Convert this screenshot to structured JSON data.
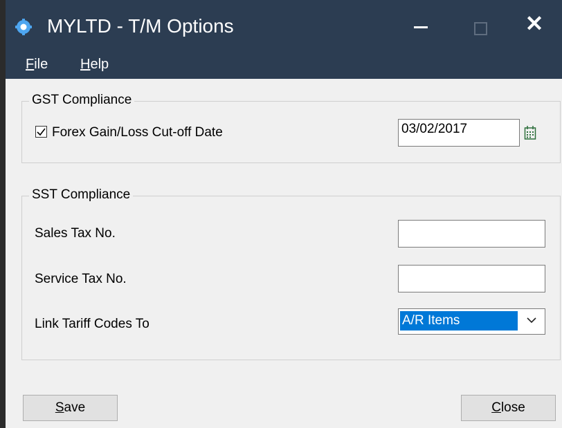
{
  "window": {
    "title": "MYLTD - T/M Options",
    "icon": "gear-icon",
    "title_bar_color": "#2c3d52"
  },
  "menu": {
    "file": {
      "accel": "F",
      "rest": "ile"
    },
    "help": {
      "accel": "H",
      "rest": "elp"
    }
  },
  "gst": {
    "group_title": "GST Compliance",
    "checkbox_label": "Forex Gain/Loss Cut-off Date",
    "checked": true,
    "date_value": "03/02/2017",
    "calendar_icon": "calendar-icon"
  },
  "sst": {
    "group_title": "SST Compliance",
    "sales_tax_label": "Sales Tax No.",
    "sales_tax_value": "",
    "service_tax_label": "Service Tax No.",
    "service_tax_value": "",
    "link_tariff_label": "Link Tariff Codes To",
    "link_tariff_value": "A/R Items"
  },
  "buttons": {
    "save": {
      "accel": "S",
      "rest": "ave"
    },
    "close": {
      "accel": "C",
      "rest": "lose"
    }
  },
  "colors": {
    "selection": "#0078d7",
    "background": "#f0f0f0"
  }
}
